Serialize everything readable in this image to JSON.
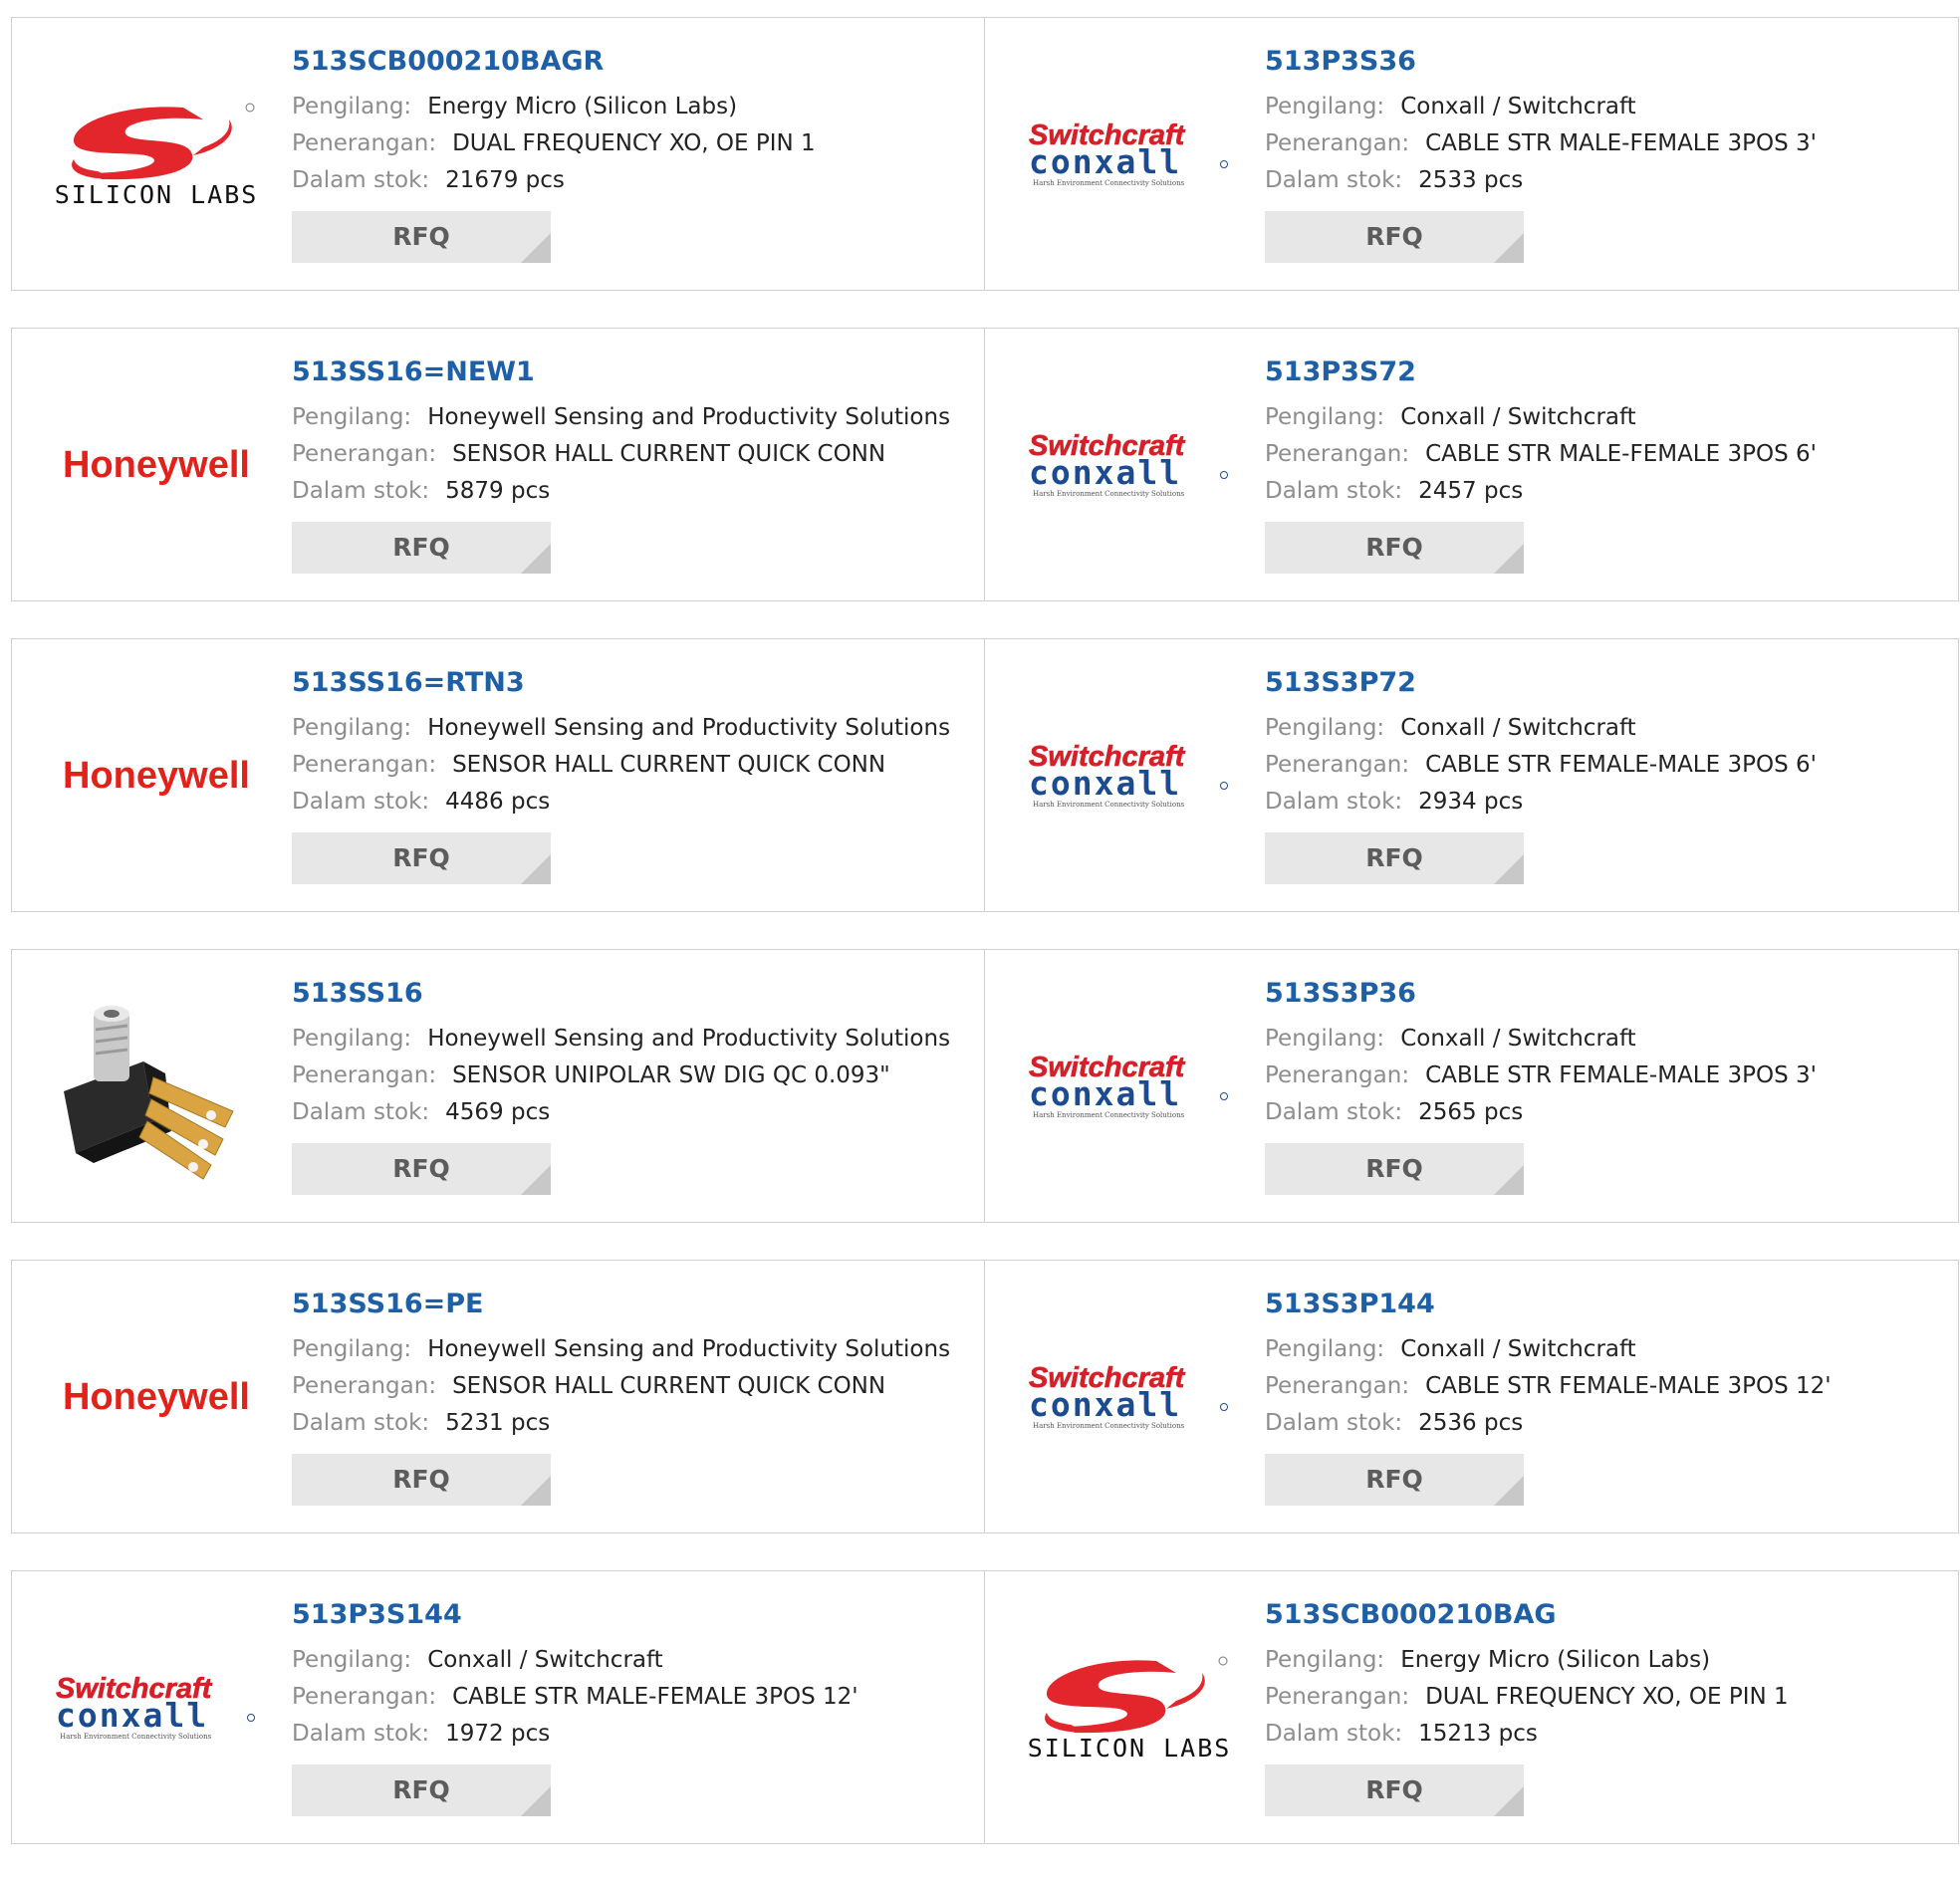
{
  "labels": {
    "manufacturer": "Pengilang:",
    "description": "Penerangan:",
    "stock": "Dalam stok:",
    "rfq": "RFQ"
  },
  "logo_text": {
    "silicon_labs": "SILICON LABS",
    "honeywell": "Honeywell",
    "switchcraft": "Switchcraft",
    "conxall": "conxall",
    "conxall_tagline": "Harsh Environment Connectivity Solutions"
  },
  "brand_colors": {
    "part_link": "#1f5fa5",
    "silicon_labs_red": "#e3262c",
    "honeywell_red": "#e32119",
    "switchcraft_red": "#d62027",
    "conxall_blue": "#1b4b91"
  },
  "products": [
    {
      "part": "513SCB000210BAGR",
      "manufacturer": "Energy Micro (Silicon Labs)",
      "description": "DUAL FREQUENCY XO, OE PIN 1",
      "stock": "21679 pcs",
      "logo": "silicon-labs-logo"
    },
    {
      "part": "513P3S36",
      "manufacturer": "Conxall / Switchcraft",
      "description": "CABLE STR MALE-FEMALE 3POS 3'",
      "stock": "2533 pcs",
      "logo": "switchcraft-conxall-logo"
    },
    {
      "part": "513SS16=NEW1",
      "manufacturer": "Honeywell Sensing and Productivity Solutions",
      "description": "SENSOR HALL CURRENT QUICK CONN",
      "stock": "5879 pcs",
      "logo": "honeywell-logo"
    },
    {
      "part": "513P3S72",
      "manufacturer": "Conxall / Switchcraft",
      "description": "CABLE STR MALE-FEMALE 3POS 6'",
      "stock": "2457 pcs",
      "logo": "switchcraft-conxall-logo"
    },
    {
      "part": "513SS16=RTN3",
      "manufacturer": "Honeywell Sensing and Productivity Solutions",
      "description": "SENSOR HALL CURRENT QUICK CONN",
      "stock": "4486 pcs",
      "logo": "honeywell-logo"
    },
    {
      "part": "513S3P72",
      "manufacturer": "Conxall / Switchcraft",
      "description": "CABLE STR FEMALE-MALE 3POS 6'",
      "stock": "2934 pcs",
      "logo": "switchcraft-conxall-logo"
    },
    {
      "part": "513SS16",
      "manufacturer": "Honeywell Sensing and Productivity Solutions",
      "description": "SENSOR UNIPOLAR SW DIG QC 0.093\"",
      "stock": "4569 pcs",
      "logo": "sensor-product-photo"
    },
    {
      "part": "513S3P36",
      "manufacturer": "Conxall / Switchcraft",
      "description": "CABLE STR FEMALE-MALE 3POS 3'",
      "stock": "2565 pcs",
      "logo": "switchcraft-conxall-logo"
    },
    {
      "part": "513SS16=PE",
      "manufacturer": "Honeywell Sensing and Productivity Solutions",
      "description": "SENSOR HALL CURRENT QUICK CONN",
      "stock": "5231 pcs",
      "logo": "honeywell-logo"
    },
    {
      "part": "513S3P144",
      "manufacturer": "Conxall / Switchcraft",
      "description": "CABLE STR FEMALE-MALE 3POS 12'",
      "stock": "2536 pcs",
      "logo": "switchcraft-conxall-logo"
    },
    {
      "part": "513P3S144",
      "manufacturer": "Conxall / Switchcraft",
      "description": "CABLE STR MALE-FEMALE 3POS 12'",
      "stock": "1972 pcs",
      "logo": "switchcraft-conxall-logo"
    },
    {
      "part": "513SCB000210BAG",
      "manufacturer": "Energy Micro (Silicon Labs)",
      "description": "DUAL FREQUENCY XO, OE PIN 1",
      "stock": "15213 pcs",
      "logo": "silicon-labs-logo"
    }
  ]
}
